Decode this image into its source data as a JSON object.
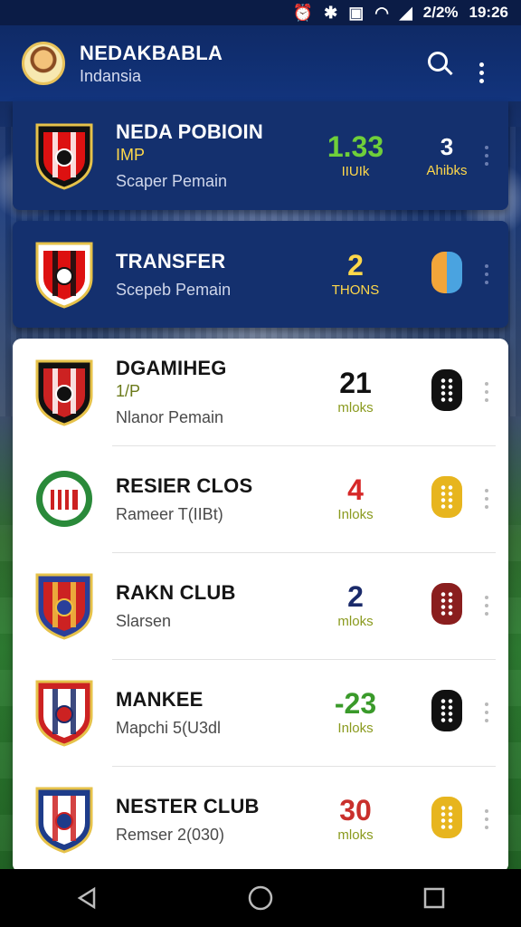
{
  "status_bar": {
    "icons": [
      "alarm-icon",
      "bluetooth-icon",
      "nfc-icon",
      "wifi-icon",
      "signal-icon"
    ],
    "battery_text": "2/2%",
    "time": "19:26"
  },
  "app_bar": {
    "title": "NEDAKBABLA",
    "subtitle": "Indansia",
    "actions": [
      "search-icon",
      "more-vert-icon"
    ]
  },
  "colors": {
    "app_bar": "#12347d",
    "dark_card": "#14306e",
    "accent_yellow": "#ffd84a",
    "accent_green": "#6fcf3a"
  },
  "clubs": [
    {
      "name": "NEDA POBIOIN",
      "tag": "IMP",
      "sub": "Scaper Pemain",
      "stat_value": "1.33",
      "stat_label": "IIUIk",
      "stat_color": "#6fcf3a",
      "badge_value": "3",
      "badge_label": "Ahibks",
      "style": "dark",
      "crest": "crest-black-red"
    },
    {
      "name": "TRANSFER",
      "tag": "",
      "sub": "Scepeb Pemain",
      "stat_value": "2",
      "stat_label": "THONS",
      "stat_color": "#ffd84a",
      "badge_icon": "transfer-pill-icon",
      "badge_color": "#f2a53a",
      "style": "dark",
      "crest": "crest-red-stripes"
    },
    {
      "name": "DGAMIHEG",
      "tag": "1/P",
      "sub": "Nlanor Pemain",
      "stat_value": "21",
      "stat_label": "mloks",
      "stat_color": "#111111",
      "badge_color": "#111111",
      "style": "light",
      "crest": "crest-ball"
    },
    {
      "name": "RESIER CLOS",
      "tag": "",
      "sub": "Rameer T(IIBt)",
      "stat_value": "4",
      "stat_label": "Inloks",
      "stat_color": "#d62828",
      "badge_color": "#e7b51e",
      "style": "light",
      "crest": "crest-green"
    },
    {
      "name": "RAKN CLUB",
      "tag": "",
      "sub": "Slarsen",
      "stat_value": "2",
      "stat_label": "mloks",
      "stat_color": "#1a2a6a",
      "badge_color": "#8a1e1e",
      "style": "light",
      "crest": "crest-blue-red"
    },
    {
      "name": "MANKEE",
      "tag": "",
      "sub": "Mapchi 5(U3dl",
      "stat_value": "-23",
      "stat_label": "Inloks",
      "stat_color": "#3a9a2a",
      "badge_color": "#111111",
      "style": "light",
      "crest": "crest-red-navy"
    },
    {
      "name": "NESTER CLUB",
      "tag": "",
      "sub": "Remser 2(030)",
      "stat_value": "30",
      "stat_label": "mloks",
      "stat_color": "#c9302c",
      "badge_color": "#e7b51e",
      "style": "light",
      "crest": "crest-navy-stripes"
    }
  ],
  "nav_bar": {
    "buttons": [
      "back-icon",
      "home-icon",
      "recents-icon"
    ]
  }
}
